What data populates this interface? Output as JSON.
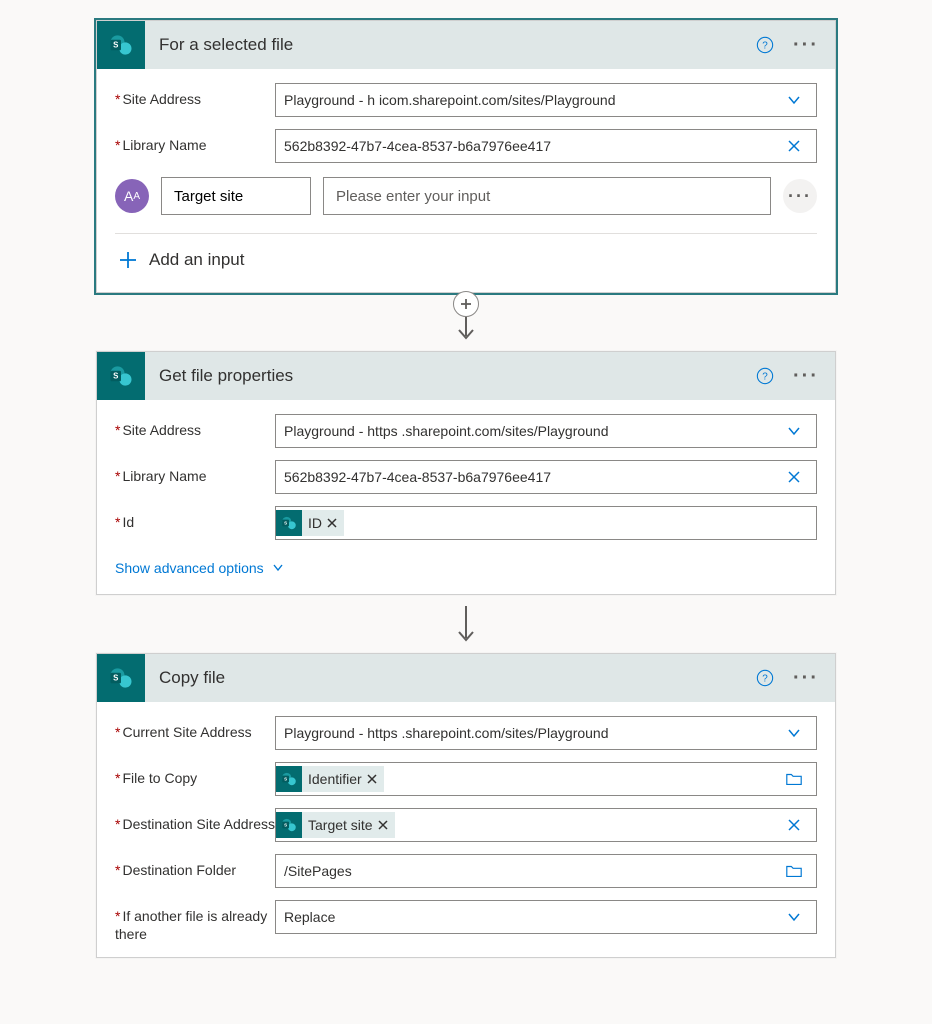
{
  "cards": [
    {
      "title": "For a selected file",
      "selected": true,
      "fields": [
        {
          "label": "Site Address",
          "value": "Playground - h                     icom.sharepoint.com/sites/Playground",
          "right": "chevron"
        },
        {
          "label": "Library Name",
          "value": "562b8392-47b7-4cea-8537-b6a7976ee417",
          "right": "clear"
        }
      ],
      "custom_input": {
        "name": "Target site",
        "prompt": "Please enter your input"
      },
      "add_input_label": "Add an input"
    },
    {
      "title": "Get file properties",
      "fields": [
        {
          "label": "Site Address",
          "value": "Playground - https                   .sharepoint.com/sites/Playground",
          "right": "chevron"
        },
        {
          "label": "Library Name",
          "value": "562b8392-47b7-4cea-8537-b6a7976ee417",
          "right": "clear"
        },
        {
          "label": "Id",
          "token": "ID"
        }
      ],
      "show_advanced": "Show advanced options"
    },
    {
      "title": "Copy file",
      "fields": [
        {
          "label": "Current Site Address",
          "value": "Playground - https                  .sharepoint.com/sites/Playground",
          "right": "chevron"
        },
        {
          "label": "File to Copy",
          "token": "Identifier",
          "right": "folder"
        },
        {
          "label": "Destination Site Address",
          "token": "Target site",
          "right": "clear"
        },
        {
          "label": "Destination Folder",
          "value": "/SitePages",
          "right": "folder"
        },
        {
          "label": "If another file is already there",
          "value": "Replace",
          "right": "chevron"
        }
      ]
    }
  ],
  "connectors": [
    "plus-arrow",
    "arrow"
  ]
}
